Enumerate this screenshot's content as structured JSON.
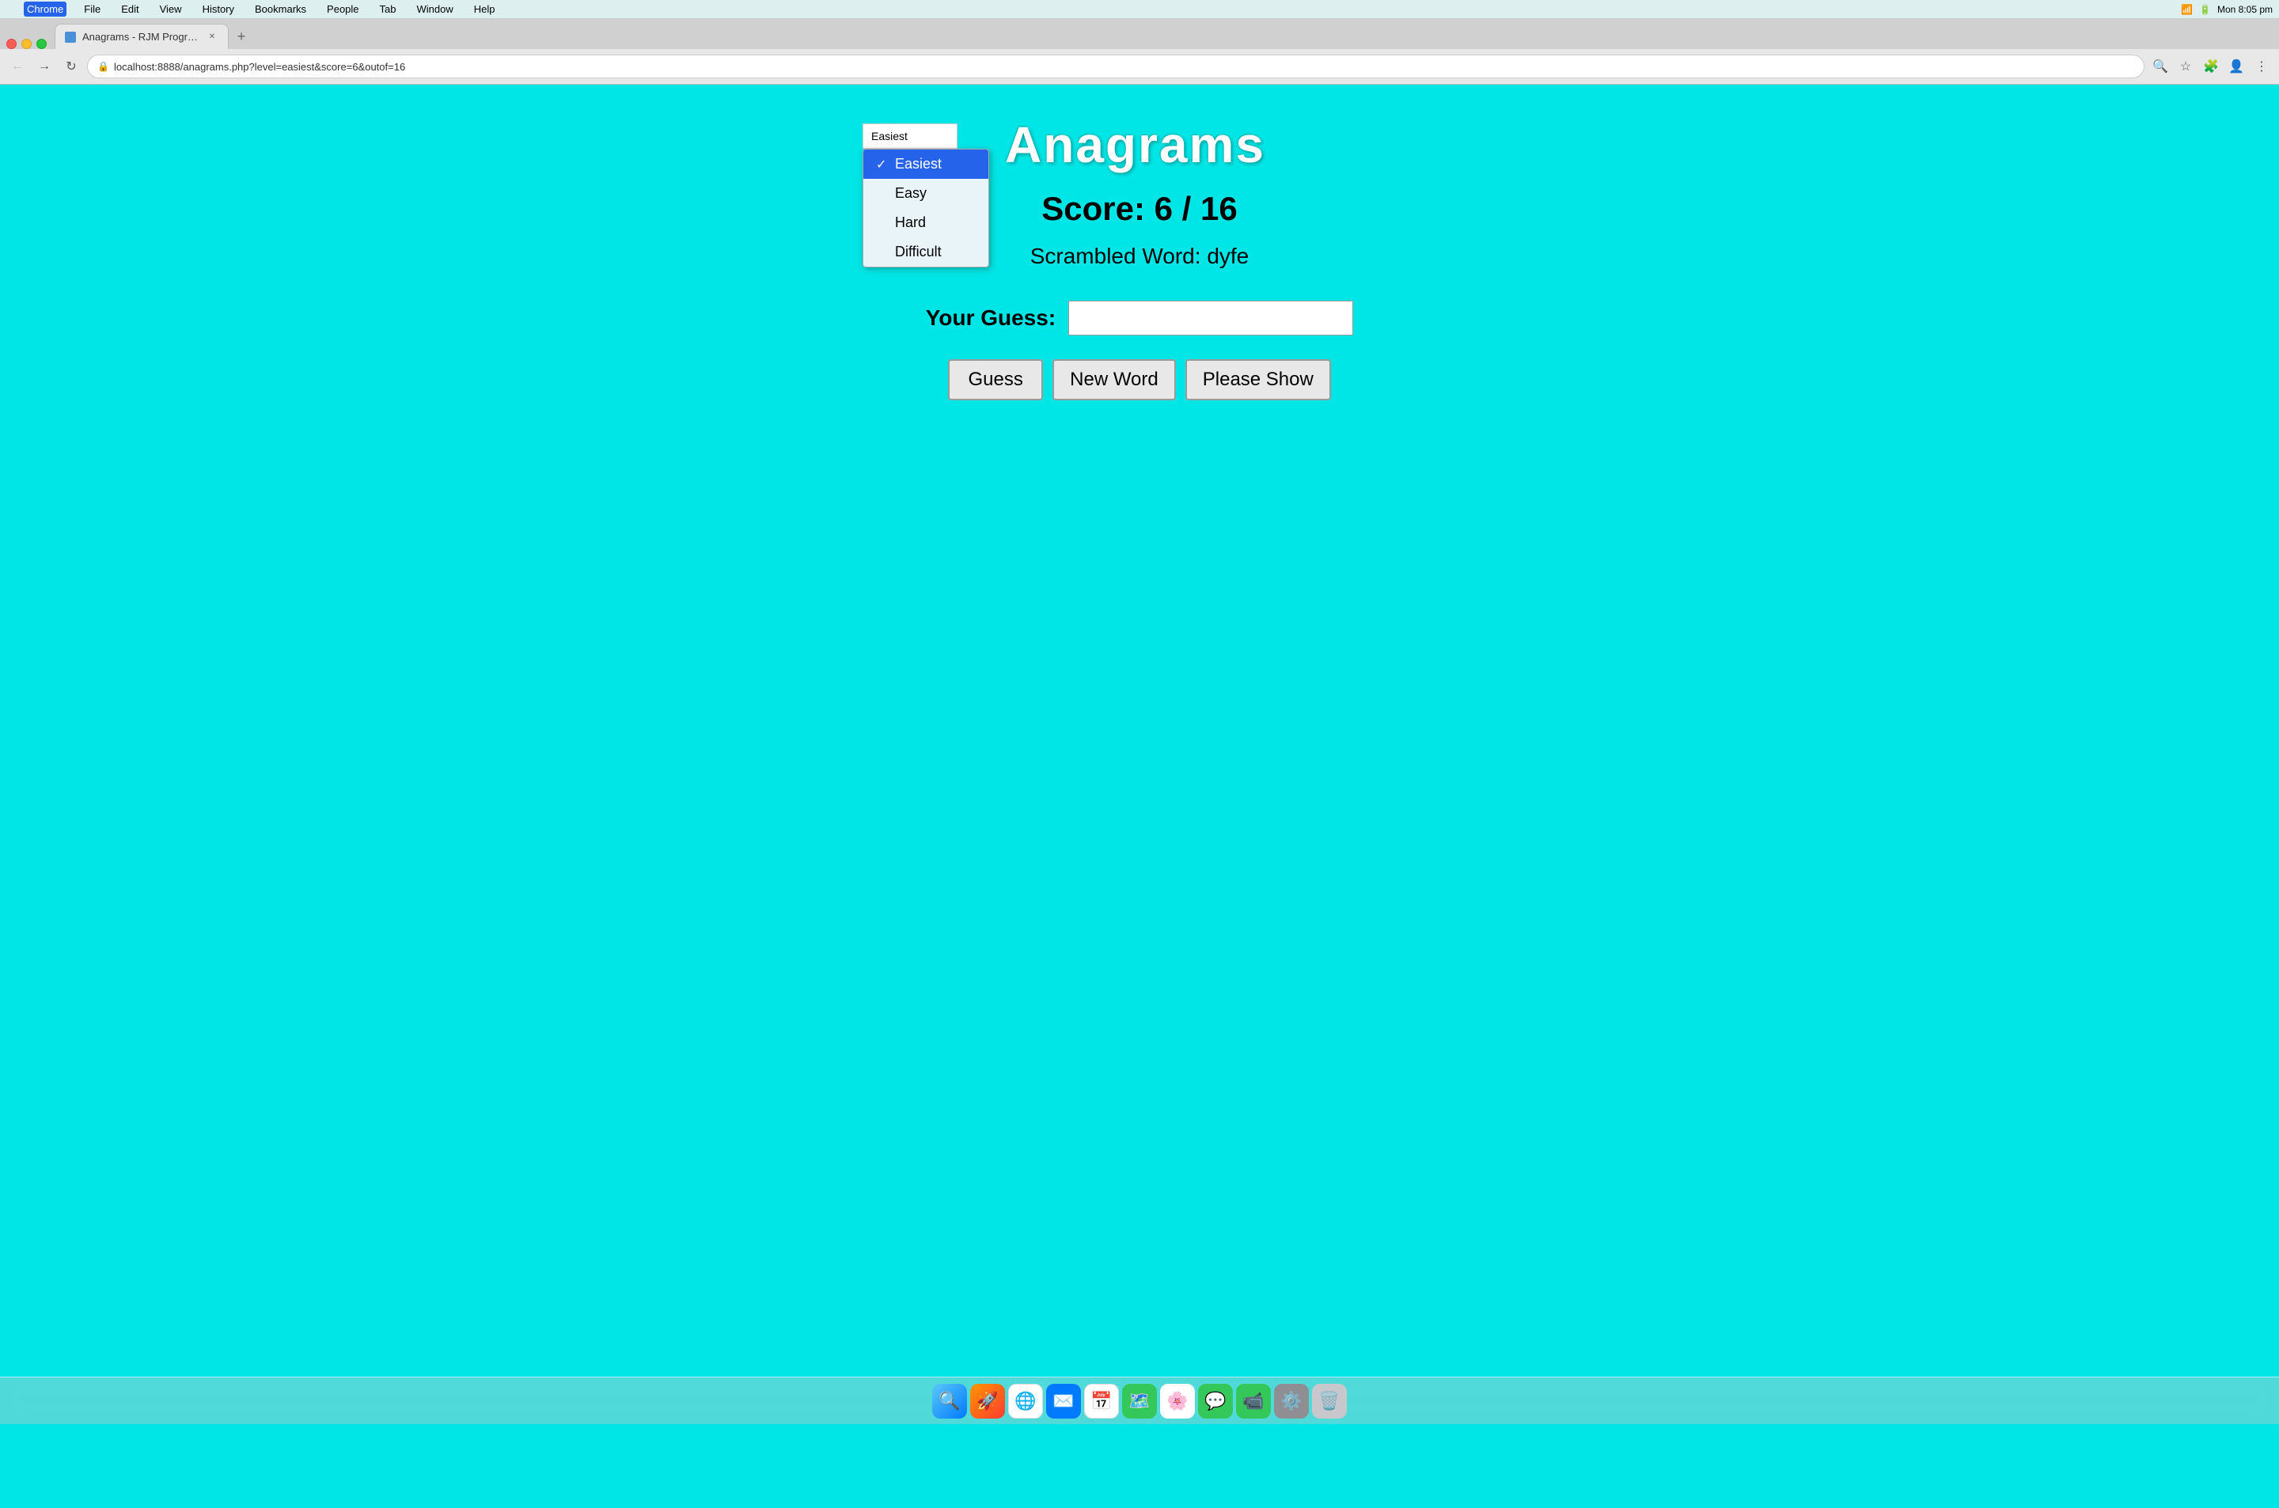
{
  "menubar": {
    "apple_symbol": "",
    "items": [
      "Chrome",
      "File",
      "Edit",
      "View",
      "History",
      "Bookmarks",
      "People",
      "Tab",
      "Window",
      "Help"
    ],
    "time": "Mon 8:05 pm",
    "battery": "100%"
  },
  "browser": {
    "tab_title": "Anagrams - RJM Programming",
    "url": "localhost:8888/anagrams.php?level=easiest&score=6&outof=16",
    "new_tab_label": "+"
  },
  "page": {
    "title": "Anagrams",
    "score_label": "Score:",
    "score_current": "6",
    "score_total": "16",
    "scrambled_label": "Scrambled Word:",
    "scrambled_word": "dyfe",
    "guess_label": "Your Guess:",
    "guess_placeholder": "",
    "buttons": {
      "guess": "Guess",
      "new_word": "New Word",
      "please_show": "Please Show"
    },
    "dropdown": {
      "options": [
        {
          "value": "easiest",
          "label": "Easiest",
          "selected": true
        },
        {
          "value": "easy",
          "label": "Easy",
          "selected": false
        },
        {
          "value": "hard",
          "label": "Hard",
          "selected": false
        },
        {
          "value": "difficult",
          "label": "Difficult",
          "selected": false
        }
      ]
    }
  },
  "colors": {
    "background": "#00e5e5",
    "dropdown_selected_bg": "#2563eb",
    "dropdown_bg": "#e8f4f8"
  }
}
